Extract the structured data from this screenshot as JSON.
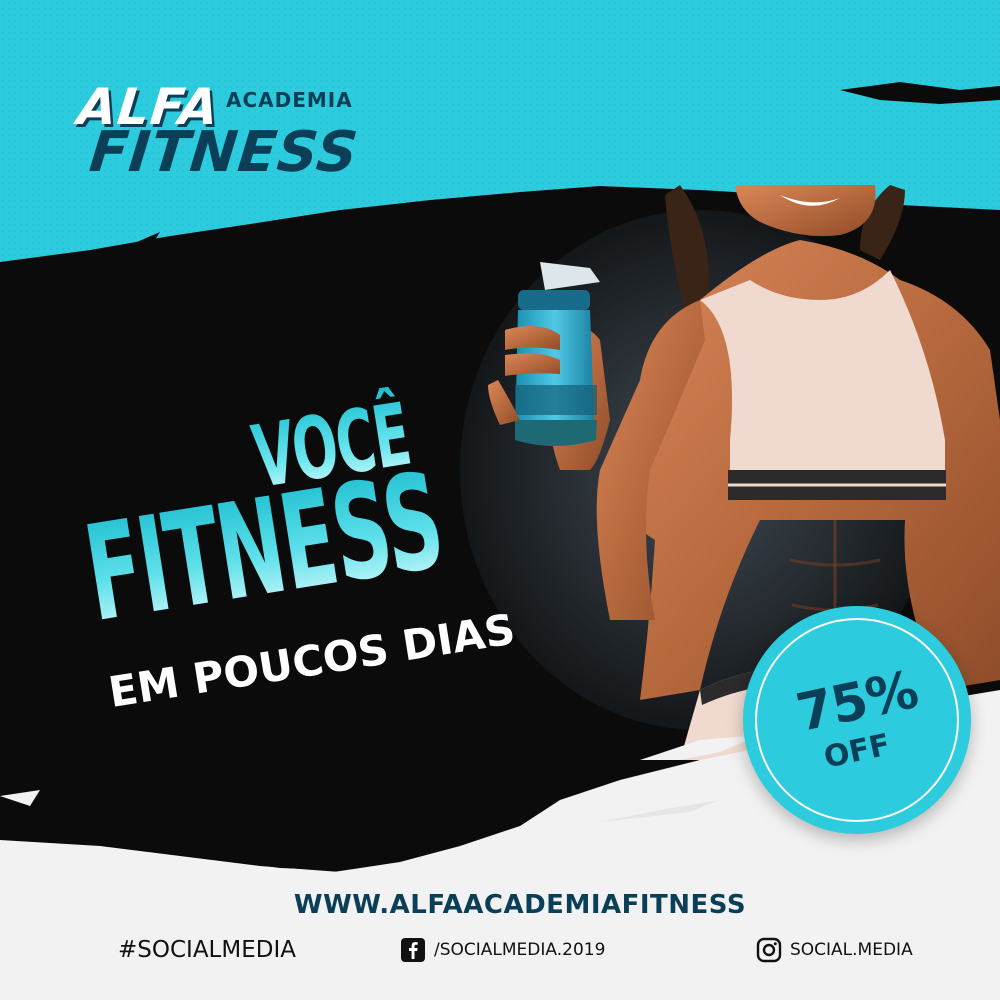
{
  "logo": {
    "line1": "ALFA",
    "line1_suffix": "ACADEMIA",
    "line2": "FITNESS"
  },
  "headline": {
    "line1": "VOCÊ",
    "line2": "FITNESS",
    "line3": "EM POUCOS DIAS"
  },
  "badge": {
    "percent": "75%",
    "label": "OFF"
  },
  "footer": {
    "website": "WWW.ALFAACADEMIAFITNESS",
    "hashtag": "#SOCIALMEDIA",
    "facebook_handle": "/SOCIALMEDIA.2019",
    "instagram_handle": "SOCIAL.MEDIA",
    "facebook_icon": "facebook-icon",
    "instagram_icon": "instagram-icon"
  },
  "colors": {
    "cyan": "#2ccbdd",
    "dark_teal": "#0a3f57",
    "black": "#0b0b0b",
    "off_white": "#f3f3f3"
  }
}
